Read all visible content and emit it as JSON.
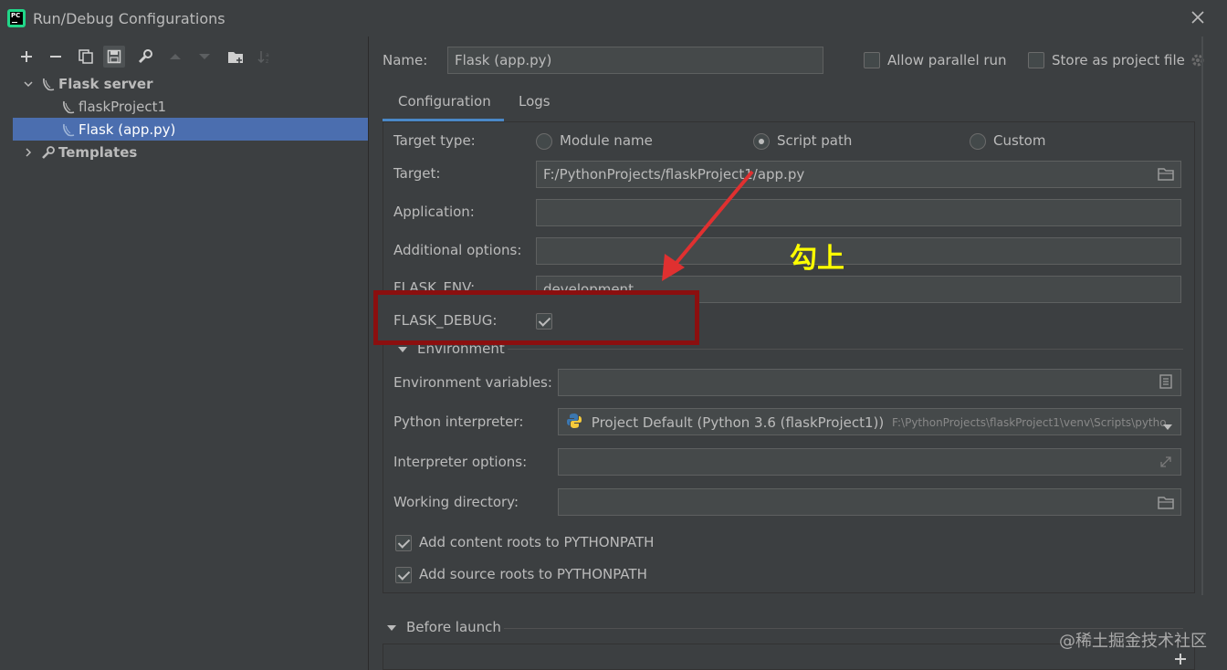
{
  "window": {
    "title": "Run/Debug Configurations",
    "app_logo_text": "PC"
  },
  "toolbar": {
    "buttons": [
      "add-icon",
      "remove-icon",
      "copy-icon",
      "save-icon",
      "wrench-icon",
      "move-up-icon",
      "move-down-icon",
      "new-folder-icon",
      "sort-icon"
    ]
  },
  "tree": {
    "group": "Flask server",
    "items": [
      "flaskProject1",
      "Flask (app.py)"
    ],
    "templates": "Templates",
    "selected": "Flask (app.py)"
  },
  "header": {
    "name_label": "Name:",
    "name_value": "Flask (app.py)",
    "allow_parallel_label": "Allow parallel run",
    "allow_parallel_checked": false,
    "store_as_project_label": "Store as project file",
    "store_as_project_checked": false
  },
  "tabs": [
    {
      "label": "Configuration",
      "active": true
    },
    {
      "label": "Logs",
      "active": false
    }
  ],
  "config": {
    "target_type_label": "Target type:",
    "target_types": [
      {
        "label": "Module name",
        "selected": false
      },
      {
        "label": "Script path",
        "selected": true
      },
      {
        "label": "Custom",
        "selected": false
      }
    ],
    "target_label": "Target:",
    "target_value": "F:/PythonProjects/flaskProject1/app.py",
    "application_label": "Application:",
    "application_value": "",
    "additional_options_label": "Additional options:",
    "additional_options_value": "",
    "flask_env_label": "FLASK_ENV:",
    "flask_env_value": "development",
    "flask_debug_label": "FLASK_DEBUG:",
    "flask_debug_checked": true,
    "environment_section": "Environment",
    "env_vars_label": "Environment variables:",
    "env_vars_value": "",
    "python_interpreter_label": "Python interpreter:",
    "python_interpreter_value": "Project Default (Python 3.6 (flaskProject1))",
    "python_interpreter_path": "F:\\PythonProjects\\flaskProject1\\venv\\Scripts\\pytho",
    "interpreter_options_label": "Interpreter options:",
    "interpreter_options_value": "",
    "working_directory_label": "Working directory:",
    "working_directory_value": "",
    "add_content_roots_label": "Add content roots to PYTHONPATH",
    "add_content_roots_checked": true,
    "add_source_roots_label": "Add source roots to PYTHONPATH",
    "add_source_roots_checked": true
  },
  "before_launch": {
    "label": "Before launch"
  },
  "annotation": {
    "text": "勾上",
    "color": "#ffff00",
    "box_color": "#8b0f0f",
    "arrow_color": "#e03030"
  },
  "watermark": "@稀土掘金技术社区"
}
